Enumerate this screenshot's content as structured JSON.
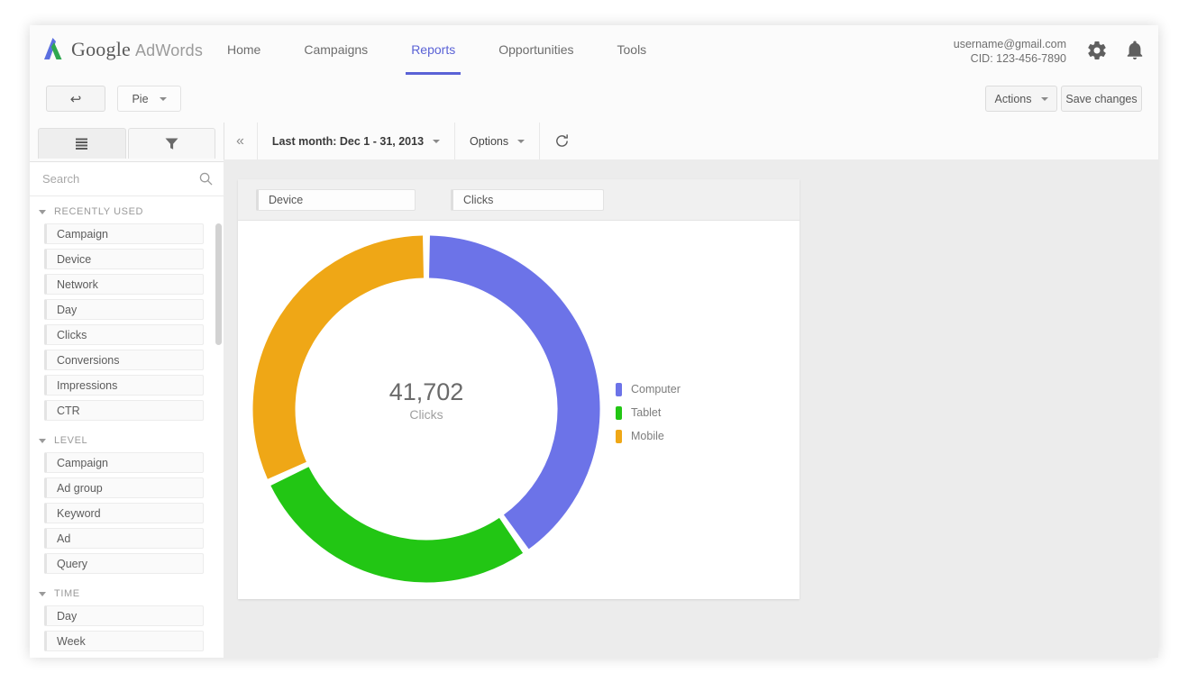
{
  "topnav": {
    "brand_google": "Google",
    "brand_product": "AdWords",
    "links": [
      {
        "label": "Home",
        "active": false
      },
      {
        "label": "Campaigns",
        "active": false
      },
      {
        "label": "Reports",
        "active": true
      },
      {
        "label": "Opportunities",
        "active": false
      },
      {
        "label": "Tools",
        "active": false
      }
    ],
    "account_email": "username@gmail.com",
    "account_cid": "CID: 123-456-7890",
    "gear_icon": "gear-icon",
    "bell_icon": "bell-icon"
  },
  "actionbar": {
    "back_label": "↩",
    "chart_type_label": "Pie",
    "actions_label": "Actions",
    "save_label": "Save changes"
  },
  "subbar": {
    "collapse_label": "«",
    "date_range": "Last month: Dec 1 - 31, 2013",
    "options_label": "Options",
    "refresh_icon": "refresh-icon"
  },
  "sidebar": {
    "tab_list_icon": "list-icon",
    "tab_filter_icon": "filter-icon",
    "search_placeholder": "Search",
    "search_value": "",
    "search_icon": "search-icon",
    "groups": [
      {
        "title": "RECENTLY USED",
        "items": [
          "Campaign",
          "Device",
          "Network",
          "Day",
          "Clicks",
          "Conversions",
          "Impressions",
          "CTR"
        ]
      },
      {
        "title": "LEVEL",
        "items": [
          "Campaign",
          "Ad group",
          "Keyword",
          "Ad",
          "Query"
        ]
      },
      {
        "title": "TIME",
        "items": [
          "Day",
          "Week"
        ]
      }
    ]
  },
  "report": {
    "dropzone_dimension": "Device",
    "dropzone_metric": "Clicks"
  },
  "chart_data": {
    "type": "pie",
    "variant": "donut",
    "title": "",
    "center_value": "41,702",
    "center_label": "Clicks",
    "total": 41702,
    "categories": [
      "Computer",
      "Tablet",
      "Mobile"
    ],
    "values": [
      16681,
      12511,
      12510
    ],
    "percentages": [
      40,
      30,
      30
    ],
    "colors": [
      "#6c73e8",
      "#22c614",
      "#efa716"
    ],
    "legend_position": "right",
    "start_angle_deg": 0,
    "segments": [
      {
        "name": "Computer",
        "color": "#6c73e8",
        "start_deg": 0,
        "end_deg": 145,
        "percent": 40.3
      },
      {
        "name": "Tablet",
        "color": "#22c614",
        "start_deg": 145,
        "end_deg": 245,
        "percent": 27.8
      },
      {
        "name": "Mobile",
        "color": "#efa716",
        "start_deg": 245,
        "end_deg": 360,
        "percent": 31.9
      }
    ]
  }
}
